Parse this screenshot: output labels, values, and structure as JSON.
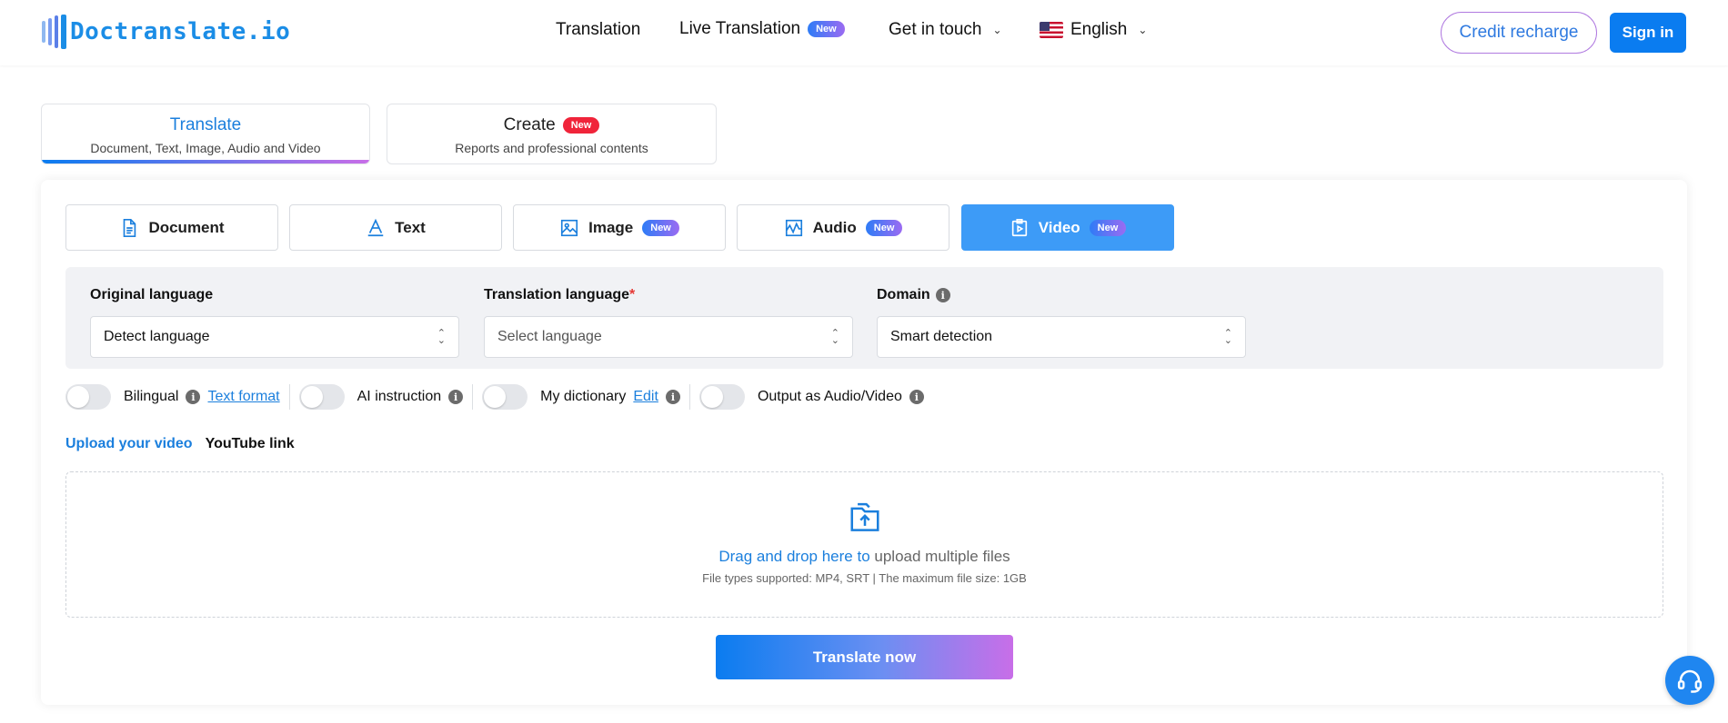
{
  "header": {
    "logo_text": "Doctranslate.io",
    "nav": {
      "translation": "Translation",
      "live_translation": "Live Translation",
      "live_badge": "New",
      "get_in_touch": "Get in touch",
      "language": "English"
    },
    "credit_recharge": "Credit recharge",
    "sign_in": "Sign in"
  },
  "modes": [
    {
      "title": "Translate",
      "subtitle": "Document, Text, Image, Audio and Video"
    },
    {
      "title": "Create",
      "badge": "New",
      "subtitle": "Reports and professional contents"
    }
  ],
  "type_tabs": [
    {
      "label": "Document",
      "icon": "document-icon"
    },
    {
      "label": "Text",
      "icon": "text-icon"
    },
    {
      "label": "Image",
      "icon": "image-icon",
      "badge": "New"
    },
    {
      "label": "Audio",
      "icon": "audio-icon",
      "badge": "New"
    },
    {
      "label": "Video",
      "icon": "video-icon",
      "badge": "New",
      "active": true
    }
  ],
  "languages": {
    "original_label": "Original language",
    "original_value": "Detect language",
    "translation_label": "Translation language",
    "translation_required": "*",
    "translation_placeholder": "Select language",
    "domain_label": "Domain",
    "domain_value": "Smart detection"
  },
  "options": {
    "bilingual": "Bilingual",
    "text_format": "Text format",
    "ai_instruction": "AI instruction",
    "my_dictionary": "My dictionary",
    "edit": "Edit",
    "output_av": "Output as Audio/Video"
  },
  "upload": {
    "tab_upload": "Upload your video",
    "tab_youtube": "YouTube link",
    "drag_highlight": "Drag and drop here to",
    "drag_rest": " upload multiple files",
    "supported": "File types supported: MP4, SRT | The maximum file size: 1GB"
  },
  "translate_button": "Translate now",
  "colors": {
    "primary": "#0a7cf0",
    "active_tab": "#3d9bf7",
    "accent_purple": "#c86ee8",
    "badge_red": "#f0243a"
  }
}
